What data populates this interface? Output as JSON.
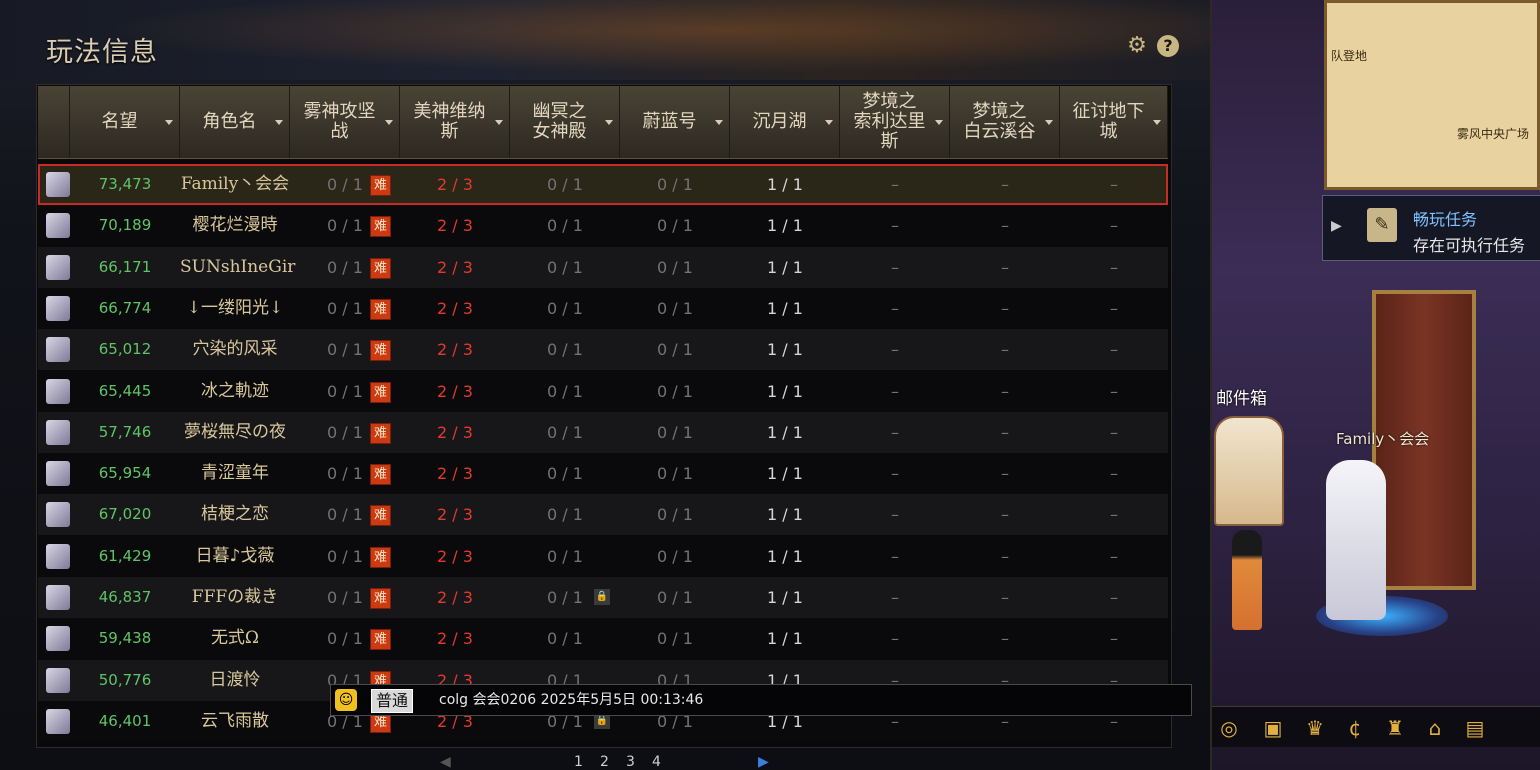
{
  "panel": {
    "title": "玩法信息",
    "icons": {
      "settings": "gear-icon",
      "help": "question-icon"
    },
    "help_glyph": "?"
  },
  "table": {
    "columns": [
      {
        "key": "fame",
        "label": "名望"
      },
      {
        "key": "name",
        "label": "角色名"
      },
      {
        "key": "c1",
        "label": "雾神攻坚\n战"
      },
      {
        "key": "c2",
        "label": "美神维纳\n斯"
      },
      {
        "key": "c3",
        "label": "幽冥之\n女神殿"
      },
      {
        "key": "c4",
        "label": "蔚蓝号"
      },
      {
        "key": "c5",
        "label": "沉月湖"
      },
      {
        "key": "c6",
        "label": "梦境之\n索利达里\n斯"
      },
      {
        "key": "c7",
        "label": "梦境之\n白云溪谷"
      },
      {
        "key": "c8",
        "label": "征讨地下\n城"
      }
    ],
    "hard_badge": "难",
    "rows": [
      {
        "fame": "73,473",
        "name": "Family丶会会",
        "c1": "0 / 1",
        "c2": "2 / 3",
        "c3": "0 / 1",
        "c4": "0 / 1",
        "c5": "1 / 1",
        "c6": "–",
        "c7": "–",
        "c8": "–",
        "locked": false,
        "selected": true
      },
      {
        "fame": "70,189",
        "name": "樱花烂漫時",
        "c1": "0 / 1",
        "c2": "2 / 3",
        "c3": "0 / 1",
        "c4": "0 / 1",
        "c5": "1 / 1",
        "c6": "–",
        "c7": "–",
        "c8": "–",
        "locked": false
      },
      {
        "fame": "66,171",
        "name": "SUNshIneGir",
        "c1": "0 / 1",
        "c2": "2 / 3",
        "c3": "0 / 1",
        "c4": "0 / 1",
        "c5": "1 / 1",
        "c6": "–",
        "c7": "–",
        "c8": "–",
        "locked": false
      },
      {
        "fame": "66,774",
        "name": "↓一缕阳光↓",
        "c1": "0 / 1",
        "c2": "2 / 3",
        "c3": "0 / 1",
        "c4": "0 / 1",
        "c5": "1 / 1",
        "c6": "–",
        "c7": "–",
        "c8": "–",
        "locked": false
      },
      {
        "fame": "65,012",
        "name": "穴染的风采",
        "c1": "0 / 1",
        "c2": "2 / 3",
        "c3": "0 / 1",
        "c4": "0 / 1",
        "c5": "1 / 1",
        "c6": "–",
        "c7": "–",
        "c8": "–",
        "locked": false
      },
      {
        "fame": "65,445",
        "name": "冰之軌迹",
        "c1": "0 / 1",
        "c2": "2 / 3",
        "c3": "0 / 1",
        "c4": "0 / 1",
        "c5": "1 / 1",
        "c6": "–",
        "c7": "–",
        "c8": "–",
        "locked": false
      },
      {
        "fame": "57,746",
        "name": "夢桜無尽の夜",
        "c1": "0 / 1",
        "c2": "2 / 3",
        "c3": "0 / 1",
        "c4": "0 / 1",
        "c5": "1 / 1",
        "c6": "–",
        "c7": "–",
        "c8": "–",
        "locked": false
      },
      {
        "fame": "65,954",
        "name": "青涩童年",
        "c1": "0 / 1",
        "c2": "2 / 3",
        "c3": "0 / 1",
        "c4": "0 / 1",
        "c5": "1 / 1",
        "c6": "–",
        "c7": "–",
        "c8": "–",
        "locked": false
      },
      {
        "fame": "67,020",
        "name": "桔梗之恋",
        "c1": "0 / 1",
        "c2": "2 / 3",
        "c3": "0 / 1",
        "c4": "0 / 1",
        "c5": "1 / 1",
        "c6": "–",
        "c7": "–",
        "c8": "–",
        "locked": false
      },
      {
        "fame": "61,429",
        "name": "日暮♪戈薇",
        "c1": "0 / 1",
        "c2": "2 / 3",
        "c3": "0 / 1",
        "c4": "0 / 1",
        "c5": "1 / 1",
        "c6": "–",
        "c7": "–",
        "c8": "–",
        "locked": false
      },
      {
        "fame": "46,837",
        "name": "FFFの裁き",
        "c1": "0 / 1",
        "c2": "2 / 3",
        "c3": "0 / 1",
        "c4": "0 / 1",
        "c5": "1 / 1",
        "c6": "–",
        "c7": "–",
        "c8": "–",
        "locked": true
      },
      {
        "fame": "59,438",
        "name": "无式Ω",
        "c1": "0 / 1",
        "c2": "2 / 3",
        "c3": "0 / 1",
        "c4": "0 / 1",
        "c5": "1 / 1",
        "c6": "–",
        "c7": "–",
        "c8": "–",
        "locked": false
      },
      {
        "fame": "50,776",
        "name": "日渡怜",
        "c1": "0 / 1",
        "c2": "2 / 3",
        "c3": "0 / 1",
        "c4": "0 / 1",
        "c5": "1 / 1",
        "c6": "–",
        "c7": "–",
        "c8": "–",
        "locked": false
      },
      {
        "fame": "46,401",
        "name": "云飞雨散",
        "c1": "0 / 1",
        "c2": "2 / 3",
        "c3": "0 / 1",
        "c4": "0 / 1",
        "c5": "1 / 1",
        "c6": "–",
        "c7": "–",
        "c8": "–",
        "locked": true
      }
    ]
  },
  "pager": {
    "prev": "◀",
    "pages": [
      "1",
      "2",
      "3",
      "4"
    ],
    "next": "▶"
  },
  "chat": {
    "emoji_icon": "smile-face-icon",
    "channel": "普通",
    "text": "colg 会会0206 2025年5月5日 00:13:46"
  },
  "scene": {
    "map_labels": [
      "队登地",
      "雾风中央广场"
    ],
    "quest_title": "畅玩任务",
    "quest_sub": "存在可执行任务",
    "mailbox_label": "邮件箱",
    "character_name": "Family丶会会",
    "bottom_icons": [
      "token-icon",
      "gift-icon",
      "crown-icon",
      "coin-icon",
      "royal-icon",
      "house-icon",
      "camera-icon"
    ]
  }
}
